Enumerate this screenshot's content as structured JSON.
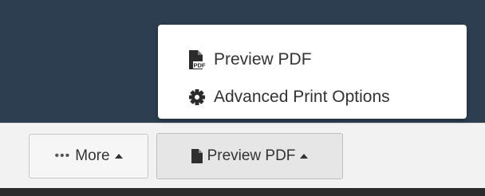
{
  "colors": {
    "header_bg": "#2c3e4f",
    "toolbar_bg": "#f2f2f2",
    "menu_bg": "#ffffff",
    "text": "#333333"
  },
  "toolbar": {
    "more_label": "More",
    "preview_label": "Preview PDF"
  },
  "dropdown": {
    "items": [
      {
        "label": "Preview PDF",
        "icon": "pdf-file-icon"
      },
      {
        "label": "Advanced Print Options",
        "icon": "cog-icon"
      }
    ]
  }
}
